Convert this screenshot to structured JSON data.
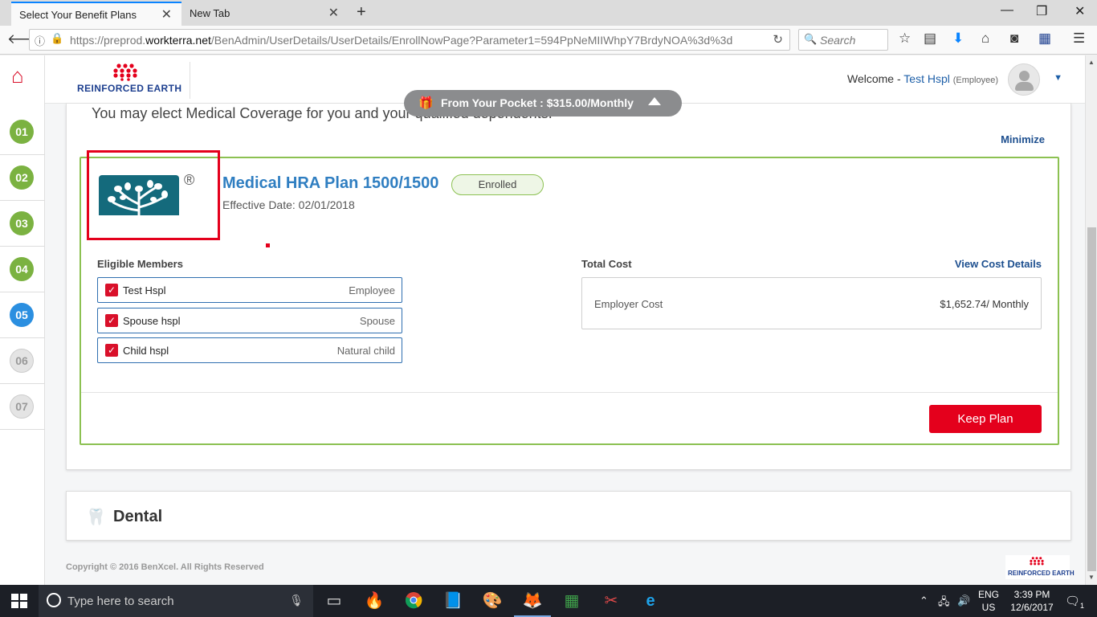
{
  "browser": {
    "tabs": [
      {
        "label": "Select Your Benefit Plans",
        "active": true
      },
      {
        "label": "New Tab",
        "active": false
      }
    ],
    "url_prefix": "https://preprod.",
    "url_host": "workterra.net",
    "url_path": "/BenAdmin/UserDetails/UserDetails/EnrollNowPage?Parameter1=594PpNeMIIWhpY7BrdyNOA%3d%3d",
    "search_placeholder": "Search",
    "icons": [
      "back-icon",
      "info-icon",
      "lock-icon",
      "reload-icon",
      "search-icon",
      "bookmark-star-icon",
      "library-icon",
      "download-icon",
      "home-icon",
      "pocket-icon",
      "new-extension-icon",
      "menu-icon"
    ]
  },
  "steps": [
    {
      "label": "01",
      "state": "done"
    },
    {
      "label": "02",
      "state": "done"
    },
    {
      "label": "03",
      "state": "done"
    },
    {
      "label": "04",
      "state": "done"
    },
    {
      "label": "05",
      "state": "current"
    },
    {
      "label": "06",
      "state": "todo"
    },
    {
      "label": "07",
      "state": "todo"
    }
  ],
  "header": {
    "logo_text": "REINFORCED EARTH",
    "welcome": "Welcome -",
    "user_name": "Test Hspl",
    "user_role": "(Employee)"
  },
  "pocket": {
    "label": "From Your Pocket : $315.00/Monthly"
  },
  "medical": {
    "intro": "You may elect Medical Coverage for you and your qualified dependents.",
    "minimize": "Minimize",
    "registered_mark": "®",
    "plan_name": "Medical HRA Plan 1500/1500",
    "effective_date": "Effective Date: 02/01/2018",
    "status": "Enrolled",
    "eligible_title": "Eligible Members",
    "members": [
      {
        "name": "Test Hspl",
        "relation": "Employee"
      },
      {
        "name": "Spouse hspl",
        "relation": "Spouse"
      },
      {
        "name": "Child hspl",
        "relation": "Natural child"
      }
    ],
    "total_cost_title": "Total Cost",
    "view_cost": "View Cost Details",
    "cost_label": "Employer Cost",
    "cost_value": "$1,652.74/ Monthly",
    "keep_plan": "Keep Plan"
  },
  "dental": {
    "title": "Dental"
  },
  "footer": {
    "copyright": "Copyright © 2016 BenXcel. All Rights Reserved",
    "logo_text": "REINFORCED EARTH"
  },
  "taskbar": {
    "search_placeholder": "Type here to search",
    "lang_line1": "ENG",
    "lang_line2": "US",
    "time": "3:39 PM",
    "date": "12/6/2017",
    "notification_count": "1"
  },
  "colors": {
    "brand_red": "#e4001c",
    "step_done": "#7bb241",
    "step_current": "#2b8fe0",
    "plan_blue": "#2f7ec1",
    "card_green": "#8cc152"
  }
}
